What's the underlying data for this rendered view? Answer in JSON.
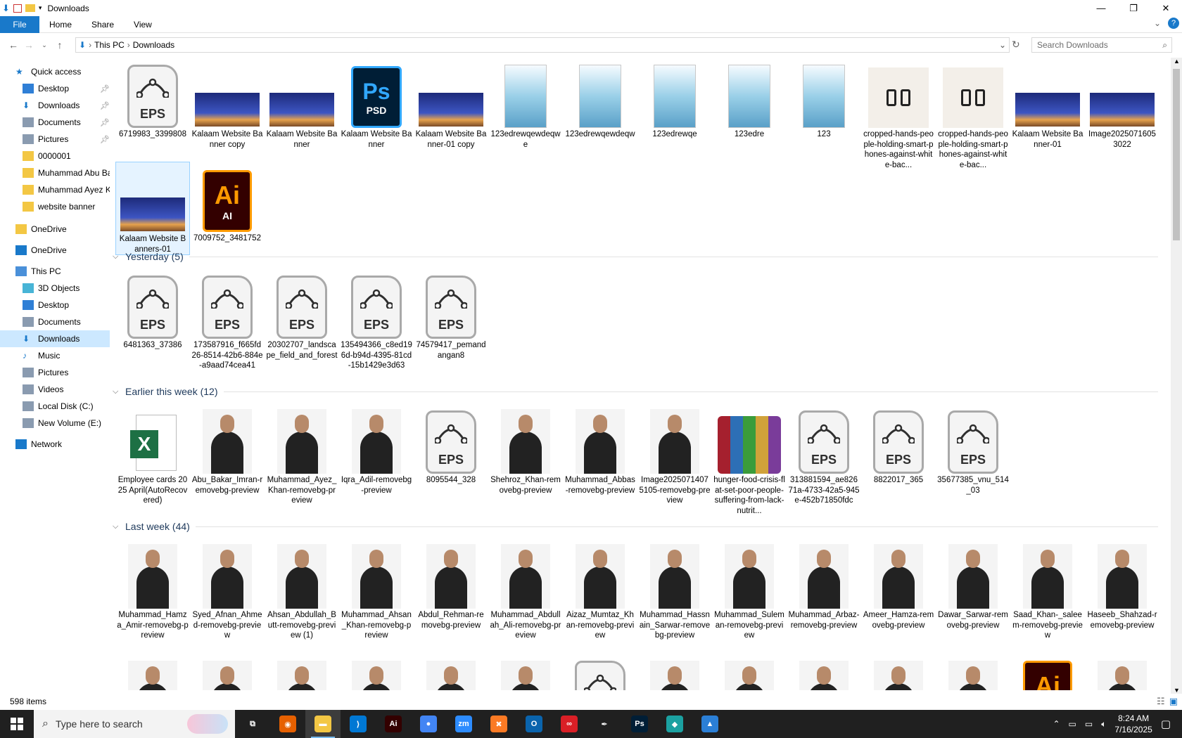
{
  "window": {
    "title": "Downloads"
  },
  "ribbon": {
    "tabs": [
      "File",
      "Home",
      "Share",
      "View"
    ]
  },
  "address": {
    "path": [
      "This PC",
      "Downloads"
    ],
    "search_placeholder": "Search Downloads"
  },
  "sidebar": {
    "items": [
      {
        "label": "Quick access",
        "icon": "star-icon",
        "indent": 0,
        "pinned": false
      },
      {
        "label": "Desktop",
        "icon": "desktop-icon",
        "indent": 1,
        "pinned": true
      },
      {
        "label": "Downloads",
        "icon": "download-icon",
        "indent": 1,
        "pinned": true
      },
      {
        "label": "Documents",
        "icon": "documents-icon",
        "indent": 1,
        "pinned": true
      },
      {
        "label": "Pictures",
        "icon": "pictures-icon",
        "indent": 1,
        "pinned": true
      },
      {
        "label": "0000001",
        "icon": "folder-icon",
        "indent": 1,
        "pinned": false
      },
      {
        "label": "Muhammad Abu Ba",
        "icon": "folder-icon",
        "indent": 1,
        "pinned": false
      },
      {
        "label": "Muhammad Ayez K",
        "icon": "folder-icon",
        "indent": 1,
        "pinned": false
      },
      {
        "label": "website banner",
        "icon": "folder-icon",
        "indent": 1,
        "pinned": false
      },
      {
        "label": "OneDrive",
        "icon": "folder-icon",
        "indent": 0,
        "pinned": false
      },
      {
        "label": "OneDrive",
        "icon": "cloud-icon",
        "indent": 0,
        "pinned": false
      },
      {
        "label": "This PC",
        "icon": "computer-icon",
        "indent": 0,
        "pinned": false
      },
      {
        "label": "3D Objects",
        "icon": "cube-icon",
        "indent": 1,
        "pinned": false
      },
      {
        "label": "Desktop",
        "icon": "desktop-icon",
        "indent": 1,
        "pinned": false
      },
      {
        "label": "Documents",
        "icon": "documents-icon",
        "indent": 1,
        "pinned": false
      },
      {
        "label": "Downloads",
        "icon": "download-icon",
        "indent": 1,
        "pinned": false
      },
      {
        "label": "Music",
        "icon": "music-icon",
        "indent": 1,
        "pinned": false
      },
      {
        "label": "Pictures",
        "icon": "pictures-icon",
        "indent": 1,
        "pinned": false
      },
      {
        "label": "Videos",
        "icon": "video-icon",
        "indent": 1,
        "pinned": false
      },
      {
        "label": "Local Disk (C:)",
        "icon": "drive-icon",
        "indent": 1,
        "pinned": false
      },
      {
        "label": "New Volume (E:)",
        "icon": "drive-icon",
        "indent": 1,
        "pinned": false
      },
      {
        "label": "Network",
        "icon": "network-icon",
        "indent": 0,
        "pinned": false
      }
    ],
    "selected": 15
  },
  "groups": {
    "today_files": [
      {
        "name": "6719983_3399808",
        "kind": "eps"
      },
      {
        "name": "Kalaam Website Banner copy",
        "kind": "banner"
      },
      {
        "name": "Kalaam Website Banner",
        "kind": "banner"
      },
      {
        "name": "Kalaam Website Banner",
        "kind": "psd"
      },
      {
        "name": "Kalaam Website Banner-01 copy",
        "kind": "banner"
      },
      {
        "name": "123edrewqewdeqwe",
        "kind": "doc"
      },
      {
        "name": "123edrewqewdeqw",
        "kind": "doc"
      },
      {
        "name": "123edrewqe",
        "kind": "doc"
      },
      {
        "name": "123edre",
        "kind": "doc"
      },
      {
        "name": "123",
        "kind": "doc"
      },
      {
        "name": "cropped-hands-people-holding-smart-phones-against-white-bac...",
        "kind": "hands"
      },
      {
        "name": "cropped-hands-people-holding-smart-phones-against-white-bac...",
        "kind": "hands"
      },
      {
        "name": "Kalaam Website Banner-01",
        "kind": "banner"
      },
      {
        "name": "Image20250716053022",
        "kind": "banner"
      },
      {
        "name": "Kalaam Website Banners-01",
        "kind": "banner"
      },
      {
        "name": "7009752_3481752",
        "kind": "ai"
      }
    ],
    "yesterday": {
      "title": "Yesterday (5)",
      "files": [
        {
          "name": "6481363_37386",
          "kind": "eps"
        },
        {
          "name": "173587916_f665fd26-8514-42b6-884e-a9aad74cea41",
          "kind": "eps"
        },
        {
          "name": "20302707_landscape_field_and_forest",
          "kind": "eps"
        },
        {
          "name": "135494366_c8ed196d-b94d-4395-81cd-15b1429e3d63",
          "kind": "eps"
        },
        {
          "name": "74579417_pemandangan8",
          "kind": "eps"
        }
      ]
    },
    "earlier": {
      "title": "Earlier this week (12)",
      "files": [
        {
          "name": "Employee cards 2025 April(AutoRecovered)",
          "kind": "excel"
        },
        {
          "name": "Abu_Bakar_Imran-removebg-preview",
          "kind": "photo"
        },
        {
          "name": "Muhammad_Ayez_Khan-removebg-preview",
          "kind": "photo"
        },
        {
          "name": "Iqra_Adil-removebg-preview",
          "kind": "photo"
        },
        {
          "name": "8095544_328",
          "kind": "eps"
        },
        {
          "name": "Shehroz_Khan-removebg-preview",
          "kind": "photo"
        },
        {
          "name": "Muhammad_Abbas-removebg-preview",
          "kind": "photo"
        },
        {
          "name": "Image20250714075105-removebg-preview",
          "kind": "photo"
        },
        {
          "name": "hunger-food-crisis-flat-set-poor-people-suffering-from-lack-nutrit...",
          "kind": "rar"
        },
        {
          "name": "313881594_ae82671a-4733-42a5-945e-452b71850fdc",
          "kind": "eps"
        },
        {
          "name": "8822017_365",
          "kind": "eps"
        },
        {
          "name": "35677385_vnu_514_03",
          "kind": "eps"
        }
      ]
    },
    "lastweek": {
      "title": "Last week (44)",
      "files": [
        {
          "name": "Muhammad_Hamza_Amir-removebg-preview",
          "kind": "photo"
        },
        {
          "name": "Syed_Afnan_Ahmed-removebg-preview",
          "kind": "photo"
        },
        {
          "name": "Ahsan_Abdullah_Butt-removebg-preview (1)",
          "kind": "photo"
        },
        {
          "name": "Muhammad_Ahsan_Khan-removebg-preview",
          "kind": "photo"
        },
        {
          "name": "Abdul_Rehman-removebg-preview",
          "kind": "photo"
        },
        {
          "name": "Muhammad_Abdullah_Ali-removebg-preview",
          "kind": "photo"
        },
        {
          "name": "Aizaz_Mumtaz_Khan-removebg-preview",
          "kind": "photo"
        },
        {
          "name": "Muhammad_Hassnain_Sarwar-removebg-preview",
          "kind": "photo"
        },
        {
          "name": "Muhammad_Suleman-removebg-preview",
          "kind": "photo"
        },
        {
          "name": "Muhammad_Arbaz-removebg-preview",
          "kind": "photo"
        },
        {
          "name": "Ameer_Hamza-removebg-preview",
          "kind": "photo"
        },
        {
          "name": "Dawar_Sarwar-removebg-preview",
          "kind": "photo"
        },
        {
          "name": "Saad_Khan-_saleem-removebg-preview",
          "kind": "photo"
        },
        {
          "name": "Haseeb_Shahzad-removebg-preview",
          "kind": "photo"
        }
      ]
    }
  },
  "status": {
    "items": "598 items"
  },
  "taskbar": {
    "search_placeholder": "Type here to search",
    "apps": [
      {
        "name": "task-view-icon",
        "glyph": "⧉",
        "color": "#202020"
      },
      {
        "name": "firefox-icon",
        "glyph": "◉",
        "color": "#e66000"
      },
      {
        "name": "file-explorer-icon",
        "glyph": "▬",
        "color": "#f3c744"
      },
      {
        "name": "vscode-icon",
        "glyph": "⟩",
        "color": "#0078d4"
      },
      {
        "name": "illustrator-icon",
        "glyph": "Ai",
        "color": "#330000"
      },
      {
        "name": "chrome-icon",
        "glyph": "●",
        "color": "#4285f4"
      },
      {
        "name": "zoom-icon",
        "glyph": "zm",
        "color": "#2d8cff"
      },
      {
        "name": "xampp-icon",
        "glyph": "✖",
        "color": "#fb7a24"
      },
      {
        "name": "outlook-icon",
        "glyph": "O",
        "color": "#0a64ad"
      },
      {
        "name": "creative-cloud-icon",
        "glyph": "∞",
        "color": "#da1f26"
      },
      {
        "name": "pen-tool-icon",
        "glyph": "✒",
        "color": "#202020"
      },
      {
        "name": "photoshop-icon",
        "glyph": "Ps",
        "color": "#001e36"
      },
      {
        "name": "app-icon",
        "glyph": "◆",
        "color": "#1ba1a1"
      },
      {
        "name": "photos-icon",
        "glyph": "▲",
        "color": "#2b7fd6"
      }
    ],
    "time": "8:24 AM",
    "date": "7/16/2025"
  }
}
